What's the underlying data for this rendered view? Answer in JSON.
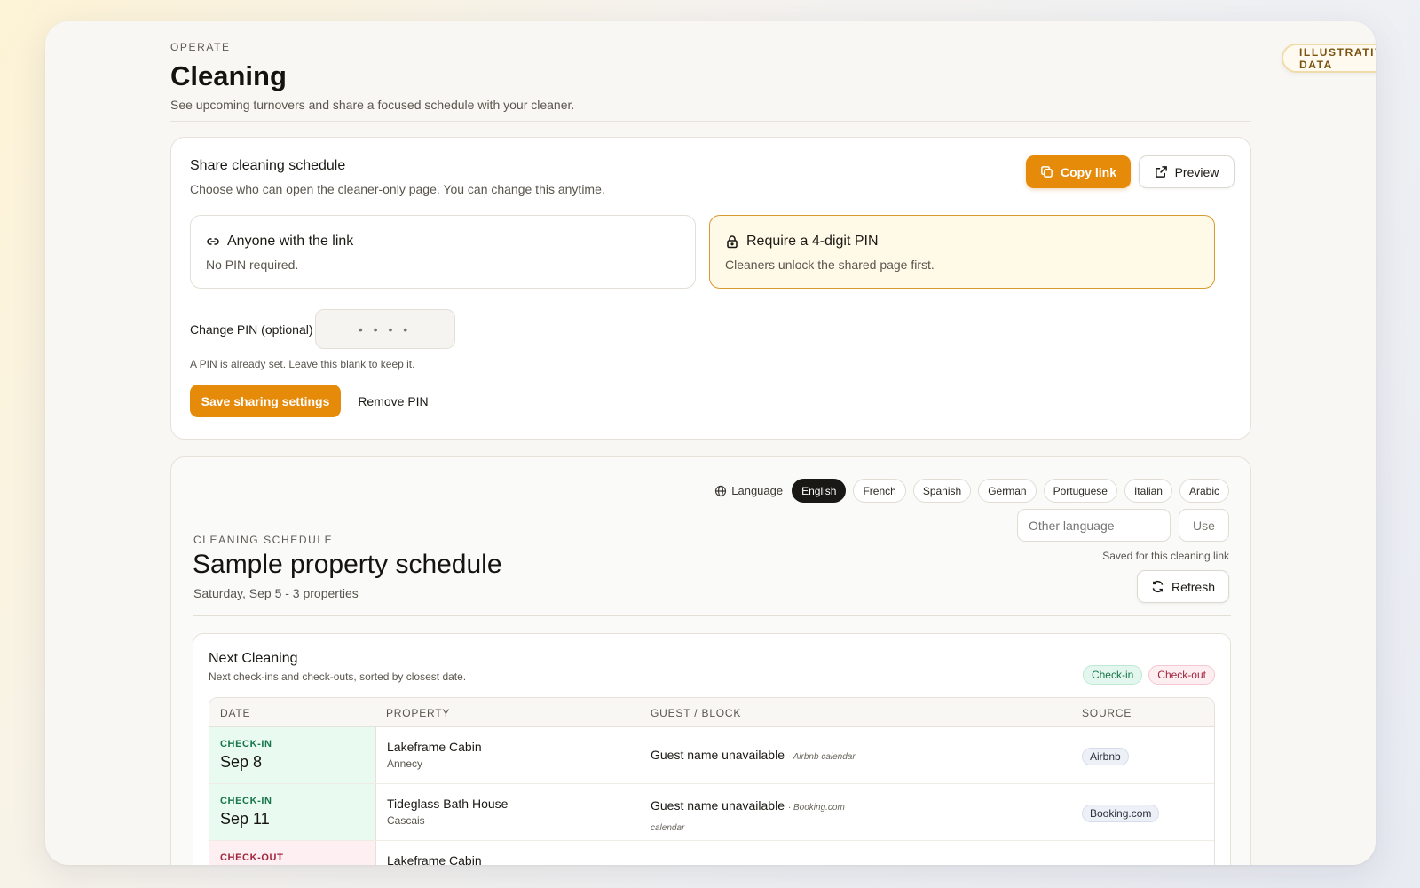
{
  "badge": "ILLUSTRATIVE DATA",
  "page": {
    "eyebrow": "OPERATE",
    "title": "Cleaning",
    "subtitle": "See upcoming turnovers and share a focused schedule with your cleaner."
  },
  "share": {
    "title": "Share cleaning schedule",
    "description": "Choose who can open the cleaner-only page. You can change this anytime.",
    "copy_label": "Copy link",
    "preview_label": "Preview",
    "options": [
      {
        "title": "Anyone with the link",
        "desc": "No PIN required.",
        "icon": "link-icon",
        "selected": false
      },
      {
        "title": "Require a 4-digit PIN",
        "desc": "Cleaners unlock the shared page first.",
        "icon": "lock-icon",
        "selected": true
      }
    ],
    "pin_label": "Change PIN (optional)",
    "pin_placeholder": "• • • •",
    "pin_help": "A PIN is already set. Leave this blank to keep it.",
    "save_label": "Save sharing settings",
    "remove_label": "Remove PIN",
    "accent": "#e68a0a"
  },
  "schedule": {
    "language_label": "Language",
    "languages": [
      "English",
      "French",
      "Spanish",
      "German",
      "Portuguese",
      "Italian",
      "Arabic"
    ],
    "selected_language": "English",
    "other_placeholder": "Other language",
    "use_label": "Use",
    "saved_note": "Saved for this cleaning link",
    "refresh_label": "Refresh",
    "eyebrow": "CLEANING SCHEDULE",
    "title": "Sample property schedule",
    "subtitle": "Saturday, Sep 5 - 3 properties"
  },
  "next": {
    "title": "Next Cleaning",
    "description": "Next check-ins and check-outs, sorted by closest date.",
    "legend": {
      "checkin": "Check-in",
      "checkout": "Check-out"
    },
    "columns": [
      "DATE",
      "PROPERTY",
      "GUEST / BLOCK",
      "SOURCE"
    ],
    "rows": [
      {
        "kind": "CHECK-IN",
        "type": "in",
        "date": "Sep 8",
        "property": "Lakeframe Cabin",
        "location": "Annecy",
        "guest": "Guest name unavailable",
        "guest_source": "· Airbnb calendar",
        "source": "Airbnb"
      },
      {
        "kind": "CHECK-IN",
        "type": "in",
        "date": "Sep 11",
        "property": "Tideglass Bath House",
        "location": "Cascais",
        "guest": "Guest name unavailable",
        "guest_source": "· Booking.com calendar",
        "source": "Booking.com"
      },
      {
        "kind": "CHECK-OUT",
        "type": "out",
        "date": "",
        "property": "Lakeframe Cabin",
        "location": "",
        "guest": "",
        "guest_source": "",
        "source": ""
      }
    ]
  }
}
